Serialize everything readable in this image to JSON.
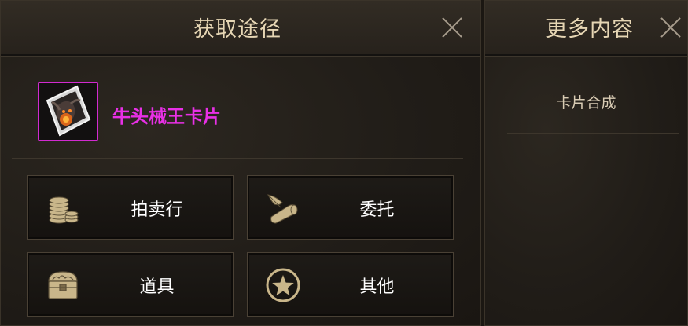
{
  "main_panel": {
    "title": "获取途径",
    "item": {
      "name": "牛头械王卡片",
      "name_color": "#e830e6",
      "border_color": "#d12ad0"
    },
    "sources": [
      {
        "label": "拍卖行",
        "icon": "coins-icon"
      },
      {
        "label": "委托",
        "icon": "scroll-quill-icon"
      },
      {
        "label": "道具",
        "icon": "treasure-chest-icon"
      },
      {
        "label": "其他",
        "icon": "star-circle-icon"
      }
    ]
  },
  "side_panel": {
    "title": "更多内容",
    "items": [
      {
        "label": "卡片合成"
      }
    ]
  }
}
